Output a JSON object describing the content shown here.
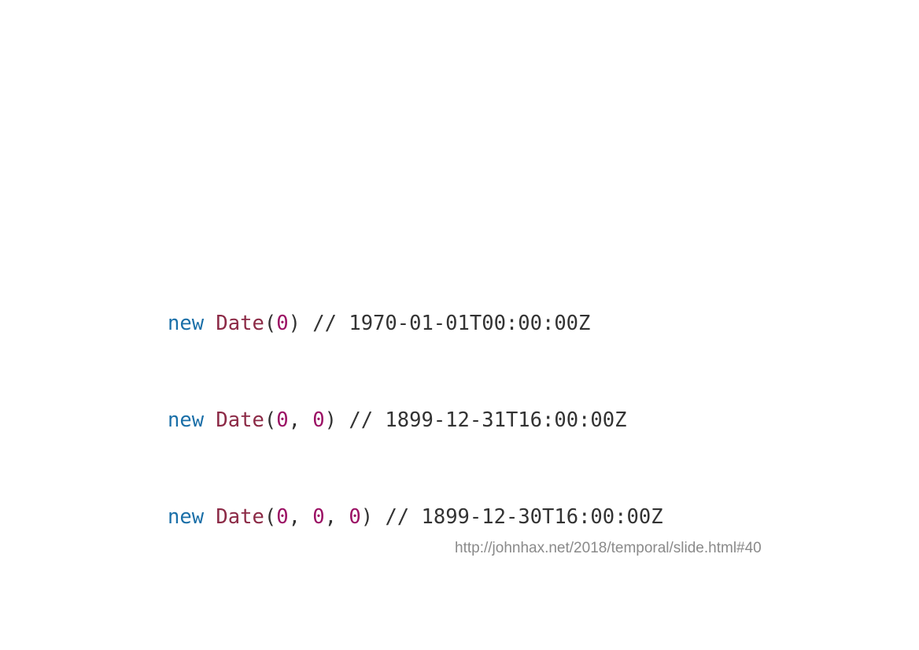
{
  "colors": {
    "keyword": "#1a6fa8",
    "function": "#8c2a46",
    "number": "#9b1064",
    "text": "#333333",
    "url": "#8a8a8a",
    "background": "#ffffff"
  },
  "code": {
    "lines": [
      {
        "keyword": "new",
        "function": "Date",
        "args": [
          "0"
        ],
        "comment": "// 1970-01-01T00:00:00Z"
      },
      {
        "keyword": "new",
        "function": "Date",
        "args": [
          "0",
          "0"
        ],
        "comment": "// 1899-12-31T16:00:00Z"
      },
      {
        "keyword": "new",
        "function": "Date",
        "args": [
          "0",
          "0",
          "0"
        ],
        "comment": "// 1899-12-30T16:00:00Z"
      }
    ]
  },
  "footer": {
    "source_url": "http://johnhax.net/2018/temporal/slide.html#40"
  }
}
